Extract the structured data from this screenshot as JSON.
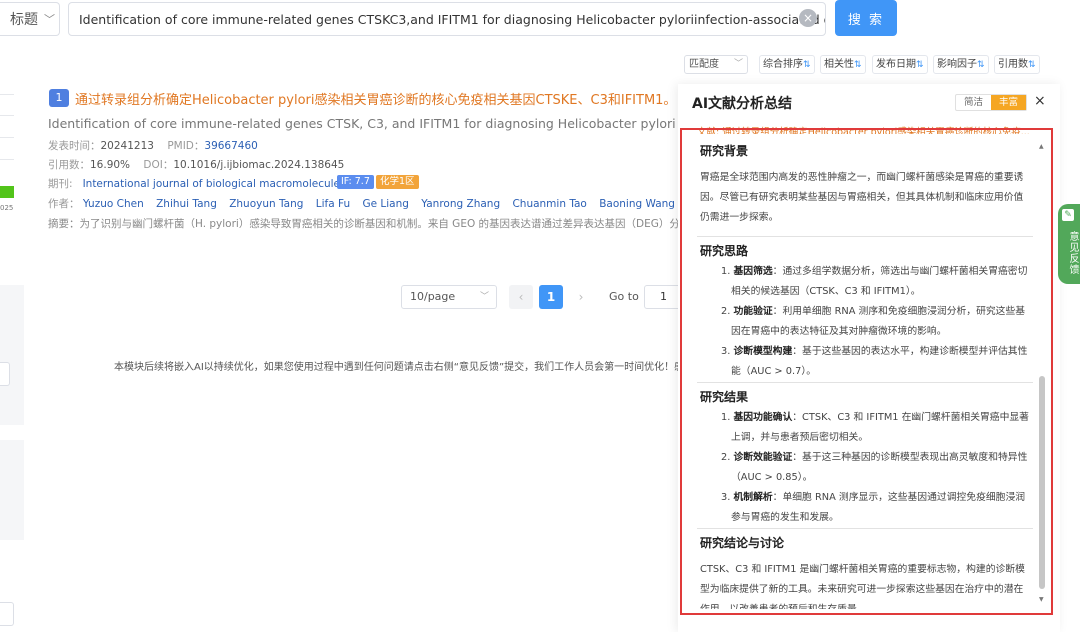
{
  "search": {
    "field": "标题",
    "query": "Identification of core immune-related genes CTSKC3,and IFITM1 for diagnosing Helicobacter pyloriinfection-associated gas",
    "button": "搜 索"
  },
  "sort": {
    "match_select": "匹配度",
    "buttons": [
      "综合排序",
      "相关性",
      "发布日期",
      "影响因子",
      "引用数"
    ]
  },
  "left": {
    "year_fragment": "025"
  },
  "result": {
    "index": "1",
    "title_cn": "通过转录组分析确定Helicobacter pylori感染相关胃癌诊断的核心免疫相关基因CTSKE、C3和IFITM1。",
    "title_en": "Identification of core immune-related genes CTSK, C3, and IFITM1 for diagnosing Helicobacter pylori infection-associated gastric cancer through transcriptomic analysis",
    "pub_label": "发表时间：",
    "pub_date": "20241213",
    "pmid_label": "PMID：",
    "pmid": "39667460",
    "cite_label": "引用数：",
    "cite_value": "16.90%",
    "doi_label": "DOI：",
    "doi": "10.1016/j.ijbiomac.2024.138645",
    "journal_label": "期刊:",
    "journal": "International journal of biological macromolecules",
    "if_badge": "IF: 7.7",
    "quartile_badge": "化学1区",
    "authors_label": "作者：",
    "authors": [
      "Yuzuo Chen",
      "Zhihui Tang",
      "Zhuoyun Tang",
      "Lifa Fu",
      "Ge Liang",
      "Yanrong Zhang",
      "Chuanmin Tao",
      "Baoning Wang"
    ],
    "abstract": "摘要：为了识别与幽门螺杆菌（H. pylori）感染导致胃癌相关的诊断基因和机制。来自 GEO 的基因表达谱通过差异表达基因（DEG）分析、加权基因共表达网络分析"
  },
  "pagination": {
    "page_size": "10/page",
    "prev": "‹",
    "current": "1",
    "next": "›",
    "goto_label": "Go to",
    "goto_value": "1"
  },
  "notice": "本模块后续将嵌入AI以持续优化，如果您使用过程中遇到任何问题请点击右侧“意见反馈”提交，我们工作人员会第一时间优化！感谢您的支持！",
  "ai_panel": {
    "title": "AI文献分析总结",
    "toggle_brief": "简洁",
    "toggle_rich": "丰富",
    "close": "×",
    "source_line": "文献: 通过转录组分析确定Helicobacter pylori感染相关胃癌诊断的核心免疫...",
    "sections": {
      "background": {
        "heading": "研究背景",
        "text": "胃癌是全球范围内高发的恶性肿瘤之一，而幽门螺杆菌感染是胃癌的重要诱因。尽管已有研究表明某些基因与胃癌相关，但其具体机制和临床应用价值仍需进一步探索。"
      },
      "approach": {
        "heading": "研究思路",
        "items": [
          {
            "num": "1.",
            "label": "基因筛选",
            "text": "：通过多组学数据分析，筛选出与幽门螺杆菌相关胃癌密切相关的候选基因（CTSK、C3 和 IFITM1）。"
          },
          {
            "num": "2.",
            "label": "功能验证",
            "text": "：利用单细胞 RNA 测序和免疫细胞浸润分析，研究这些基因在胃癌中的表达特征及其对肿瘤微环境的影响。"
          },
          {
            "num": "3.",
            "label": "诊断模型构建",
            "text": "：基于这些基因的表达水平，构建诊断模型并评估其性能（AUC > 0.7）。"
          }
        ]
      },
      "results": {
        "heading": "研究结果",
        "items": [
          {
            "num": "1.",
            "label": "基因功能确认",
            "text": "：CTSK、C3 和 IFITM1 在幽门螺杆菌相关胃癌中显著上调，并与患者预后密切相关。"
          },
          {
            "num": "2.",
            "label": "诊断效能验证",
            "text": "：基于这三种基因的诊断模型表现出高灵敏度和特异性（AUC > 0.85）。"
          },
          {
            "num": "3.",
            "label": "机制解析",
            "text": "：单细胞 RNA 测序显示，这些基因通过调控免疫细胞浸润参与胃癌的发生和发展。"
          }
        ]
      },
      "conclusion": {
        "heading": "研究结论与讨论",
        "text": "CTSK、C3 和 IFITM1 是幽门螺杆菌相关胃癌的重要标志物，构建的诊断模型为临床提供了新的工具。未来研究可进一步探索这些基因在治疗中的潜在作用，以改善患者的预后和生存质量。"
      }
    }
  },
  "feedback": "意见反馈",
  "colors": {
    "accent": "#4096f7",
    "title_orange": "#e07722",
    "frame_red": "#e03a3a",
    "feedback_green": "#52a85a"
  }
}
